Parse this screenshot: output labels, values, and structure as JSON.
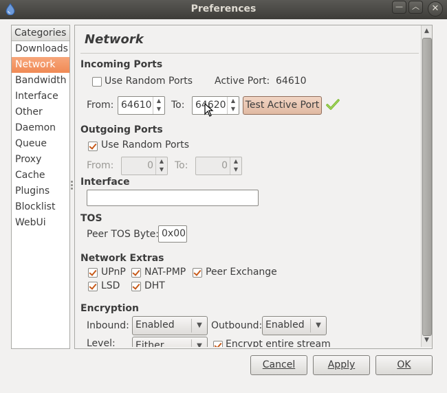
{
  "window": {
    "title": "Preferences"
  },
  "categories": {
    "header": "Categories",
    "items": [
      {
        "label": "Downloads"
      },
      {
        "label": "Network",
        "selected": true
      },
      {
        "label": "Bandwidth"
      },
      {
        "label": "Interface"
      },
      {
        "label": "Other"
      },
      {
        "label": "Daemon"
      },
      {
        "label": "Queue"
      },
      {
        "label": "Proxy"
      },
      {
        "label": "Cache"
      },
      {
        "label": "Plugins"
      },
      {
        "label": "Blocklist"
      },
      {
        "label": "WebUi"
      }
    ]
  },
  "network": {
    "title": "Network",
    "incoming": {
      "heading": "Incoming Ports",
      "random_label": "Use Random Ports",
      "random_checked": false,
      "active_port_label": "Active Port:",
      "active_port_value": "64610",
      "from_label": "From:",
      "from_value": "64610",
      "to_label": "To:",
      "to_value": "64620",
      "test_button": "Test Active Port",
      "test_status": "check-icon"
    },
    "outgoing": {
      "heading": "Outgoing Ports",
      "random_label": "Use Random Ports",
      "random_checked": true,
      "from_label": "From:",
      "from_value": "0",
      "to_label": "To:",
      "to_value": "0"
    },
    "interface": {
      "heading": "Interface",
      "value": ""
    },
    "tos": {
      "heading": "TOS",
      "label": "Peer TOS Byte:",
      "value": "0x00"
    },
    "extras": {
      "heading": "Network Extras",
      "upnp": "UPnP",
      "natpmp": "NAT-PMP",
      "pex": "Peer Exchange",
      "lsd": "LSD",
      "dht": "DHT"
    },
    "encryption": {
      "heading": "Encryption",
      "inbound_label": "Inbound:",
      "inbound_value": "Enabled",
      "outbound_label": "Outbound:",
      "outbound_value": "Enabled",
      "level_label": "Level:",
      "level_value": "Either",
      "encrypt_label": "Encrypt entire stream"
    }
  },
  "buttons": {
    "cancel": "Cancel",
    "apply": "Apply",
    "ok": "OK"
  },
  "colors": {
    "accent": "#f08a55",
    "check": "#7dbb2f"
  }
}
